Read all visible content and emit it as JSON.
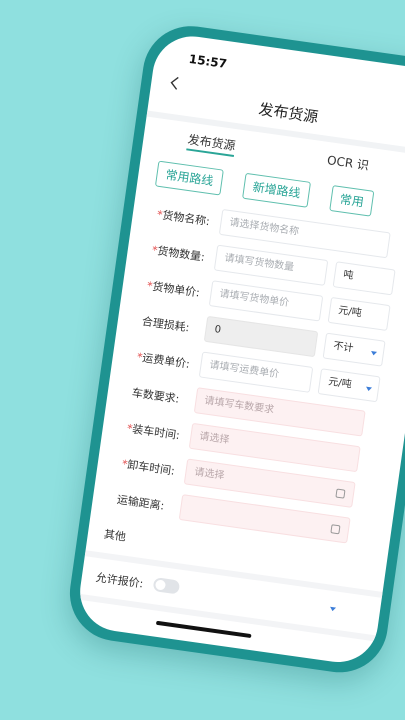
{
  "status": {
    "time": "15:57"
  },
  "header": {
    "title": "发布货源"
  },
  "tabs": {
    "publish": "发布货源",
    "ocr": "OCR 识"
  },
  "route_buttons": {
    "common": "常用路线",
    "add": "新增路线",
    "common2": "常用"
  },
  "form": {
    "goods_name": {
      "label": "货物名称:",
      "placeholder": "请选择货物名称"
    },
    "goods_qty": {
      "label": "货物数量:",
      "placeholder": "请填写货物数量",
      "unit": "吨"
    },
    "unit_price": {
      "label": "货物单价:",
      "placeholder": "请填写货物单价",
      "unit": "元/吨"
    },
    "loss": {
      "label": "合理损耗:",
      "value": "0",
      "unit": "不计"
    },
    "freight_price": {
      "label": "运费单价:",
      "placeholder": "请填写运费单价",
      "unit": "元/吨"
    },
    "vehicle_req": {
      "label": "车数要求:",
      "placeholder": "请填写车数要求"
    },
    "load_time": {
      "label": "装车时间:",
      "placeholder": "请选择"
    },
    "unload_time": {
      "label": "卸车时间:",
      "placeholder": "请选择"
    },
    "distance": {
      "label": "运输距离:"
    },
    "other": {
      "label": "其他"
    },
    "allow_bid": {
      "label": "允许报价:"
    }
  },
  "required_mark": "*"
}
